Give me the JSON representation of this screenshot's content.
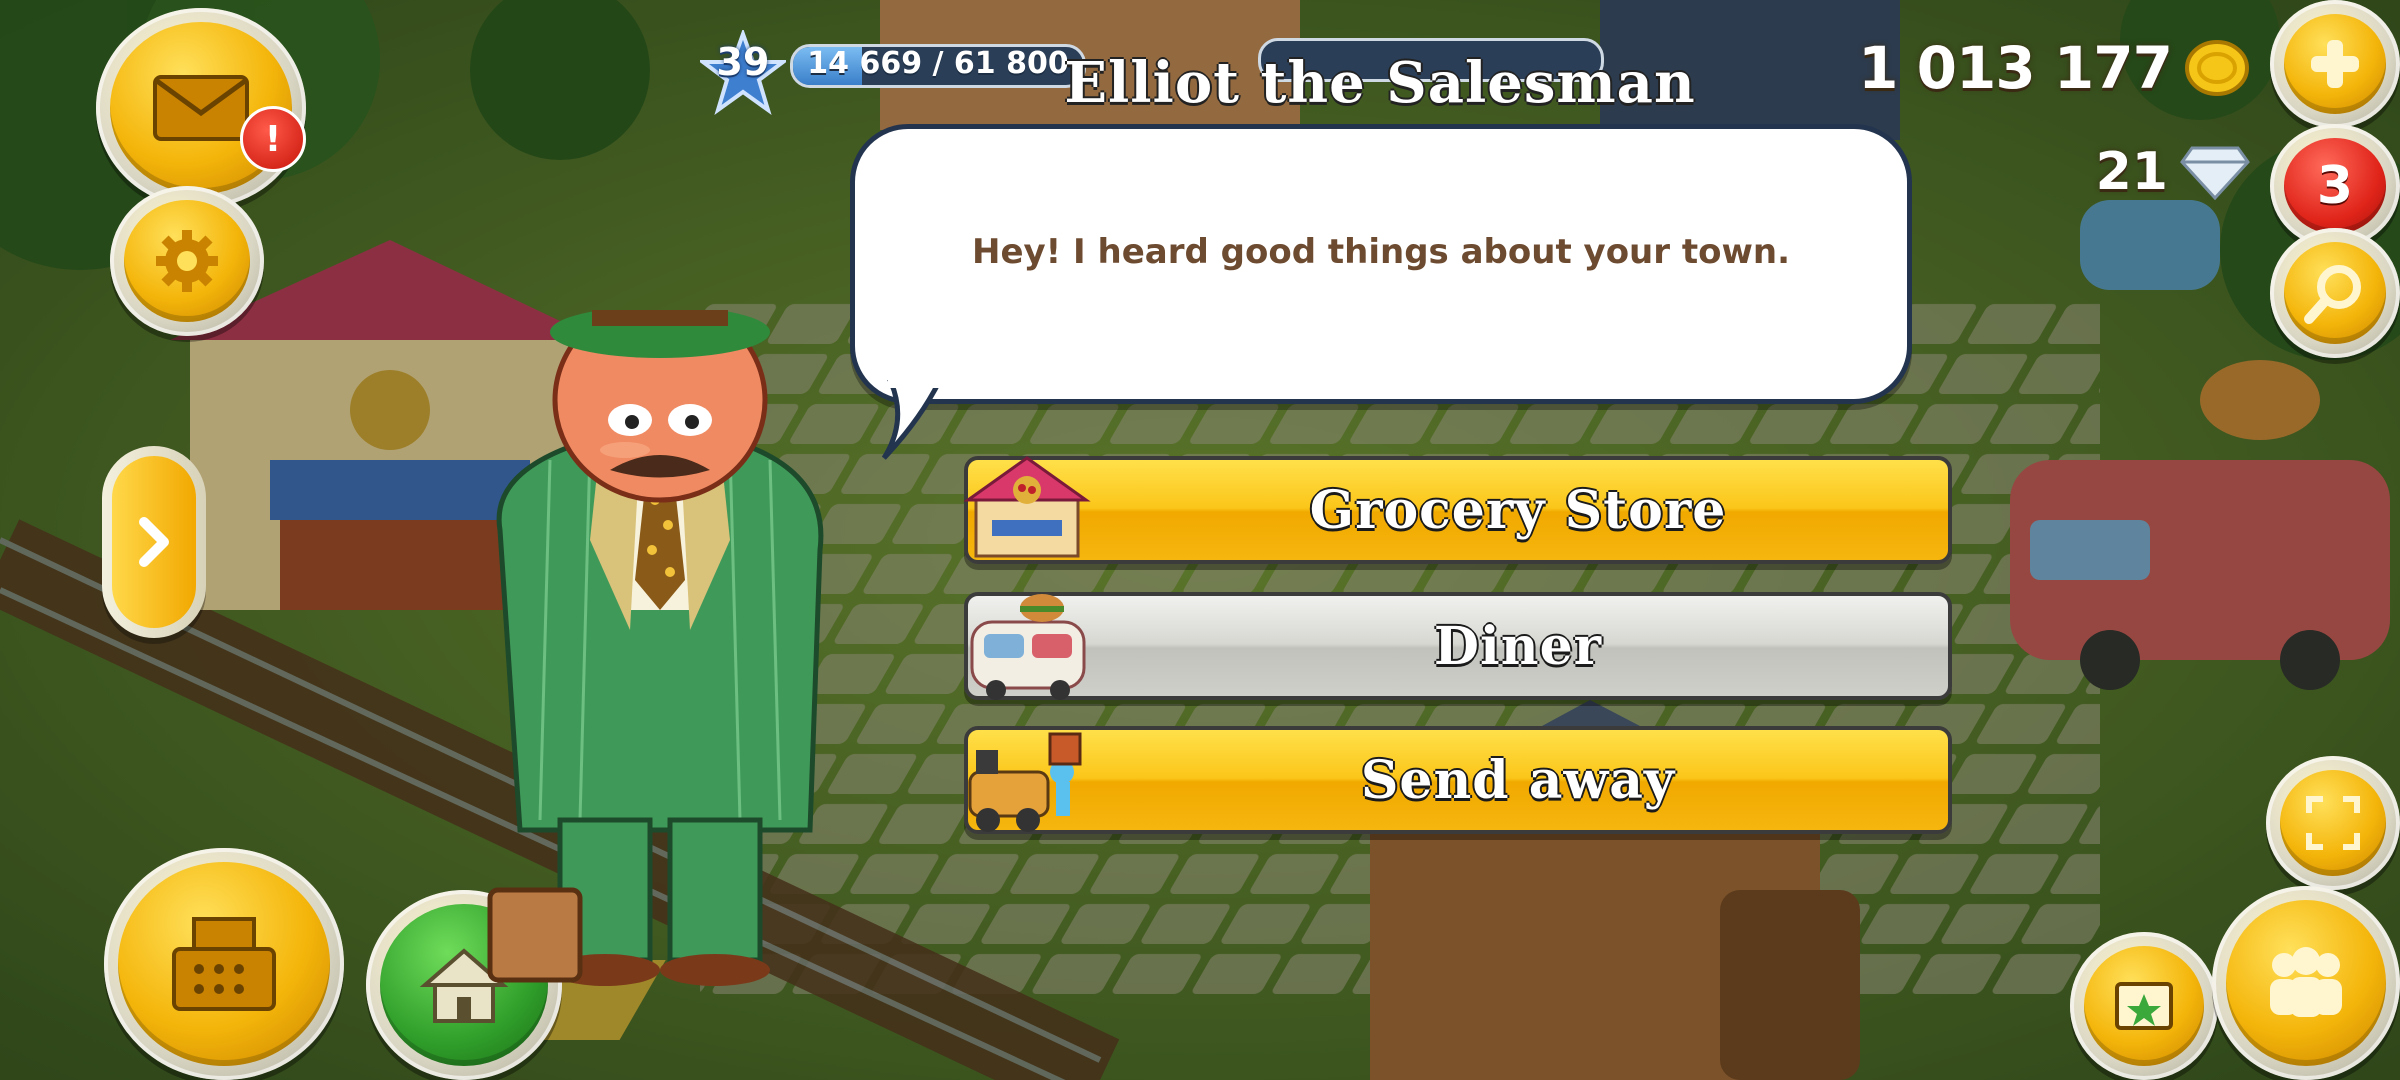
{
  "hud": {
    "level": "39",
    "xp_text": "14 669 / 61 800",
    "xp_progress": 0.237,
    "coins": "1 013 177",
    "gems": "21",
    "mail_badge": "!",
    "notification_count": "3"
  },
  "dialog": {
    "title": "Elliot the Salesman",
    "speech": "Hey! I heard good things about your town.",
    "options": [
      {
        "label": "Grocery Store",
        "style": "yellow"
      },
      {
        "label": "Diner",
        "style": "grey"
      },
      {
        "label": "Send away",
        "style": "yellow"
      }
    ]
  },
  "colors": {
    "accent_yellow": "#f6b60e",
    "grass": "#4e6a2a",
    "bubble_border": "#23344f",
    "speech_text": "#6d4b30"
  },
  "icons": {
    "mail": "mail-icon",
    "settings": "gear-icon",
    "plus": "plus-icon",
    "search": "magnifier-icon",
    "cash_register": "cash-register-icon",
    "home": "home-icon",
    "fullscreen": "expand-icon",
    "friends": "friends-icon",
    "photo": "photo-album-icon",
    "arrow": "chevron-right-icon"
  }
}
